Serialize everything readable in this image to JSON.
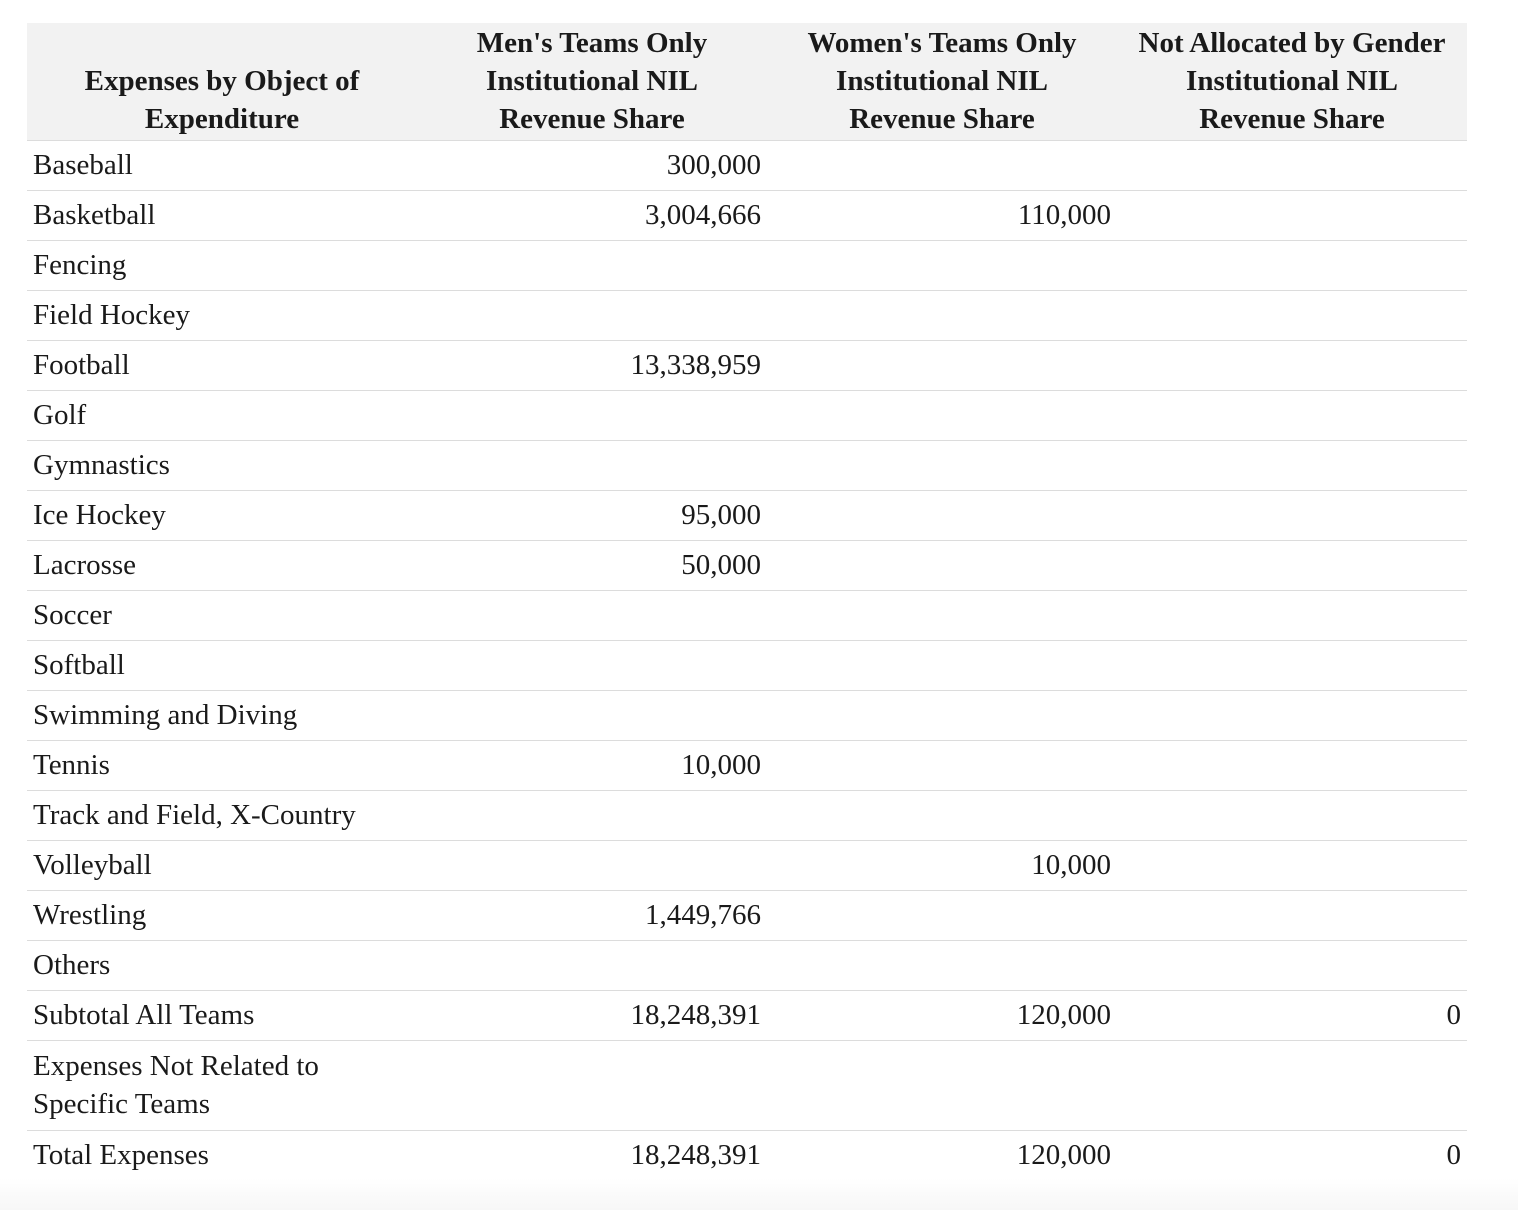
{
  "table": {
    "headers": [
      [
        "Expenses by Object of",
        "Expenditure"
      ],
      [
        "Men's Teams Only",
        "Institutional NIL",
        "Revenue Share"
      ],
      [
        "Women's Teams Only",
        "Institutional NIL",
        "Revenue Share"
      ],
      [
        "Not Allocated by Gender",
        "Institutional NIL",
        "Revenue Share"
      ]
    ],
    "rows": [
      {
        "label": "Baseball",
        "men": "300,000",
        "women": "",
        "not_allocated": ""
      },
      {
        "label": "Basketball",
        "men": "3,004,666",
        "women": "110,000",
        "not_allocated": ""
      },
      {
        "label": "Fencing",
        "men": "",
        "women": "",
        "not_allocated": ""
      },
      {
        "label": "Field Hockey",
        "men": "",
        "women": "",
        "not_allocated": ""
      },
      {
        "label": "Football",
        "men": "13,338,959",
        "women": "",
        "not_allocated": ""
      },
      {
        "label": "Golf",
        "men": "",
        "women": "",
        "not_allocated": ""
      },
      {
        "label": "Gymnastics",
        "men": "",
        "women": "",
        "not_allocated": ""
      },
      {
        "label": "Ice Hockey",
        "men": "95,000",
        "women": "",
        "not_allocated": ""
      },
      {
        "label": "Lacrosse",
        "men": "50,000",
        "women": "",
        "not_allocated": ""
      },
      {
        "label": "Soccer",
        "men": "",
        "women": "",
        "not_allocated": ""
      },
      {
        "label": "Softball",
        "men": "",
        "women": "",
        "not_allocated": ""
      },
      {
        "label": "Swimming and Diving",
        "men": "",
        "women": "",
        "not_allocated": ""
      },
      {
        "label": "Tennis",
        "men": "10,000",
        "women": "",
        "not_allocated": ""
      },
      {
        "label": "Track and Field, X-Country",
        "men": "",
        "women": "",
        "not_allocated": ""
      },
      {
        "label": "Volleyball",
        "men": "",
        "women": "10,000",
        "not_allocated": ""
      },
      {
        "label": "Wrestling",
        "men": "1,449,766",
        "women": "",
        "not_allocated": ""
      },
      {
        "label": "Others",
        "men": "",
        "women": "",
        "not_allocated": ""
      },
      {
        "label": "Subtotal All Teams",
        "men": "18,248,391",
        "women": "120,000",
        "not_allocated": "0"
      },
      {
        "label": "Expenses Not Related to Specific Teams",
        "men": "",
        "women": "",
        "not_allocated": ""
      },
      {
        "label": "Total Expenses",
        "men": "18,248,391",
        "women": "120,000",
        "not_allocated": "0"
      }
    ]
  }
}
